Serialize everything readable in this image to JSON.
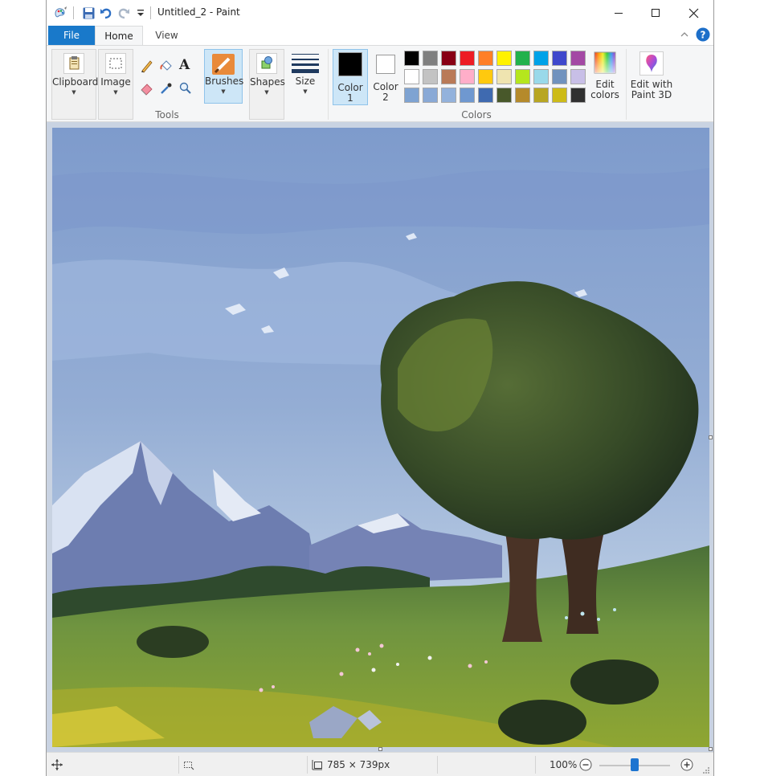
{
  "window": {
    "title": "Untitled_2 - Paint"
  },
  "quick_access": {
    "icons": [
      "paint-app-icon",
      "save-icon",
      "undo-icon",
      "redo-icon",
      "customize-qat-icon"
    ]
  },
  "tabs": {
    "file": "File",
    "home": "Home",
    "view": "View"
  },
  "ribbon": {
    "clipboard": "Clipboard",
    "image": "Image",
    "tools_group": "Tools",
    "brushes": "Brushes",
    "shapes": "Shapes",
    "size": "Size",
    "color1_line1": "Color",
    "color1_line2": "1",
    "color2_line1": "Color",
    "color2_line2": "2",
    "edit_colors_line1": "Edit",
    "edit_colors_line2": "colors",
    "edit3d_line1": "Edit with",
    "edit3d_line2": "Paint 3D",
    "colors_group": "Colors"
  },
  "palette": {
    "row1": [
      "#000000",
      "#7f7f7f",
      "#880015",
      "#ed1c24",
      "#ff7f27",
      "#fff200",
      "#22b14c",
      "#00a2e8",
      "#3f48cc",
      "#a349a4"
    ],
    "row2": [
      "#ffffff",
      "#c3c3c3",
      "#b97a57",
      "#ffaec9",
      "#ffc90e",
      "#efe4b0",
      "#b5e61d",
      "#99d9ea",
      "#7092be",
      "#c8bfe7"
    ],
    "row3": [
      "#7ea3d2",
      "#89a9d6",
      "#93b2dc",
      "#6f98d0",
      "#3f6ab0",
      "#48582a",
      "#b58a2b",
      "#b8a622",
      "#cdbb18",
      "#303030"
    ],
    "color1": "#000000",
    "color2": "#ffffff"
  },
  "status": {
    "dimensions": "785 × 739px",
    "zoom": "100%",
    "zoom_level": 0.5
  }
}
